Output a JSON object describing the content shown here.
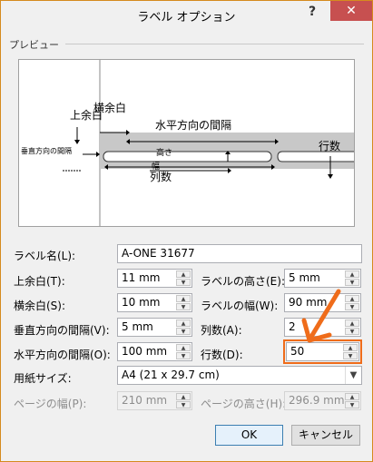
{
  "window": {
    "title": "ラベル オプション",
    "help": "?",
    "close": "✕"
  },
  "preview": {
    "group_title": "プレビュー",
    "labels": {
      "top_margin": "上余白",
      "side_margin": "横余白",
      "horizontal_pitch": "水平方向の間隔",
      "vertical_pitch": "垂直方向の間隔",
      "height": "高さ",
      "width": "幅",
      "columns": "列数",
      "rows": "行数"
    }
  },
  "form": {
    "label_name": {
      "label": "ラベル名(L):",
      "value": "A-ONE 31677"
    },
    "top_margin": {
      "label": "上余白(T):",
      "value": "11 mm"
    },
    "label_height": {
      "label": "ラベルの高さ(E):",
      "value": "5 mm"
    },
    "side_margin": {
      "label": "横余白(S):",
      "value": "10 mm"
    },
    "label_width": {
      "label": "ラベルの幅(W):",
      "value": "90 mm"
    },
    "vertical_pitch": {
      "label": "垂直方向の間隔(V):",
      "value": "5 mm"
    },
    "columns": {
      "label": "列数(A):",
      "value": "2"
    },
    "horizontal_pitch": {
      "label": "水平方向の間隔(O):",
      "value": "100 mm"
    },
    "rows": {
      "label": "行数(D):",
      "value": "50"
    },
    "paper_size": {
      "label": "用紙サイズ:",
      "value": "A4 (21 x 29.7 cm)"
    },
    "page_width": {
      "label": "ページの幅(P):",
      "value": "210 mm"
    },
    "page_height": {
      "label": "ページの高さ(H):",
      "value": "296.9 mm"
    }
  },
  "buttons": {
    "ok": "OK",
    "cancel": "キャンセル"
  },
  "colors": {
    "highlight": "#ef6c1a",
    "close": "#c75050",
    "label_fill": "#c8c8c8"
  }
}
